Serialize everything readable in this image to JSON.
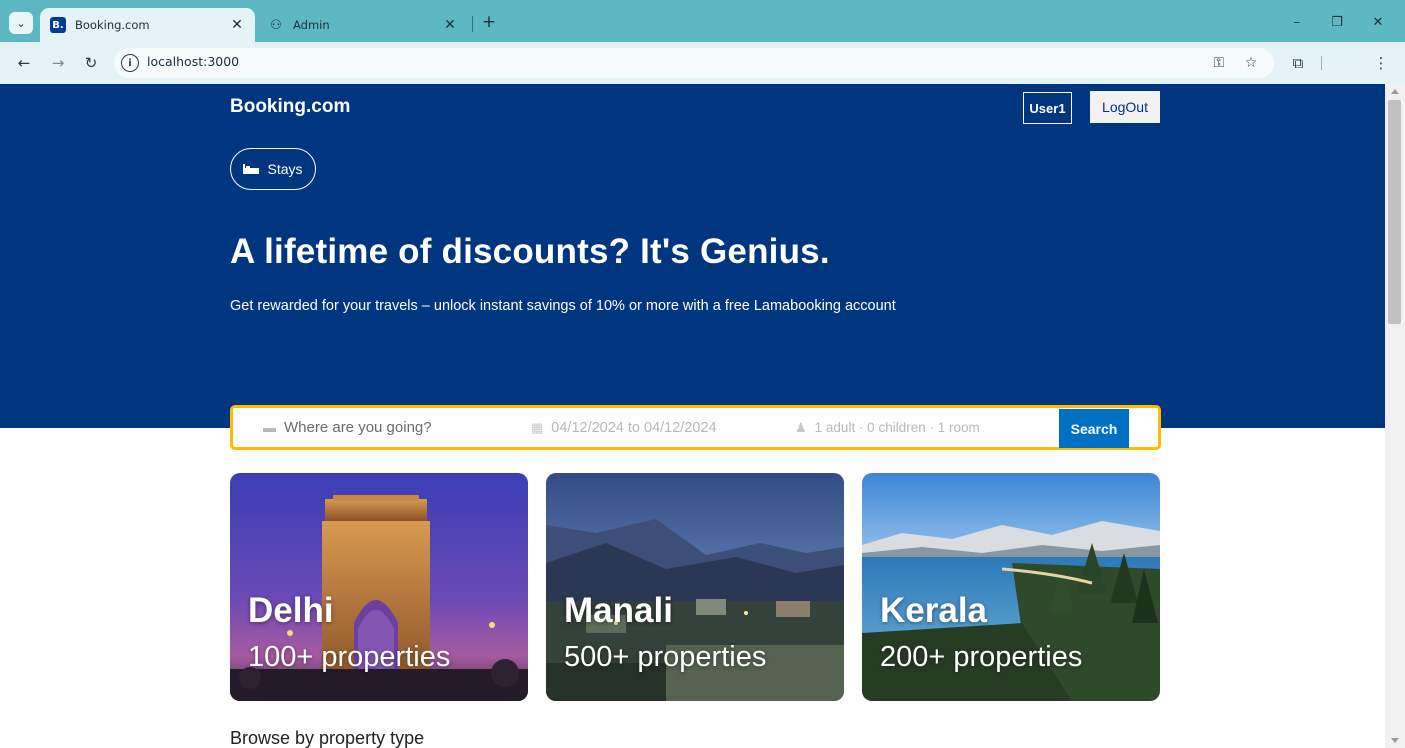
{
  "browser": {
    "tabs": [
      {
        "title": "Booking.com",
        "favicon": "booking-b-icon",
        "active": true
      },
      {
        "title": "Admin",
        "favicon": "admin-icon",
        "active": false
      }
    ],
    "url": "localhost:3000"
  },
  "header": {
    "logo": "Booking.com",
    "user_label": "User1",
    "logout_label": "LogOut",
    "nav_tab_label": "Stays"
  },
  "hero": {
    "title": "A lifetime of discounts? It's Genius.",
    "subtitle": "Get rewarded for your travels – unlock instant savings of 10% or more with a free Lamabooking account"
  },
  "search": {
    "destination_placeholder": "Where are you going?",
    "date_range": "04/12/2024 to 04/12/2024",
    "options": "1 adult · 0 children · 1 room",
    "button_label": "Search"
  },
  "featured": [
    {
      "city": "Delhi",
      "count": "100+ properties"
    },
    {
      "city": "Manali",
      "count": "500+ properties"
    },
    {
      "city": "Kerala",
      "count": "200+ properties"
    }
  ],
  "sections": {
    "property_type_title": "Browse by property type"
  },
  "colors": {
    "brand_blue": "#003580",
    "accent_yellow": "#febb02",
    "button_blue": "#0071c2",
    "chrome_teal": "#5db8c4"
  }
}
